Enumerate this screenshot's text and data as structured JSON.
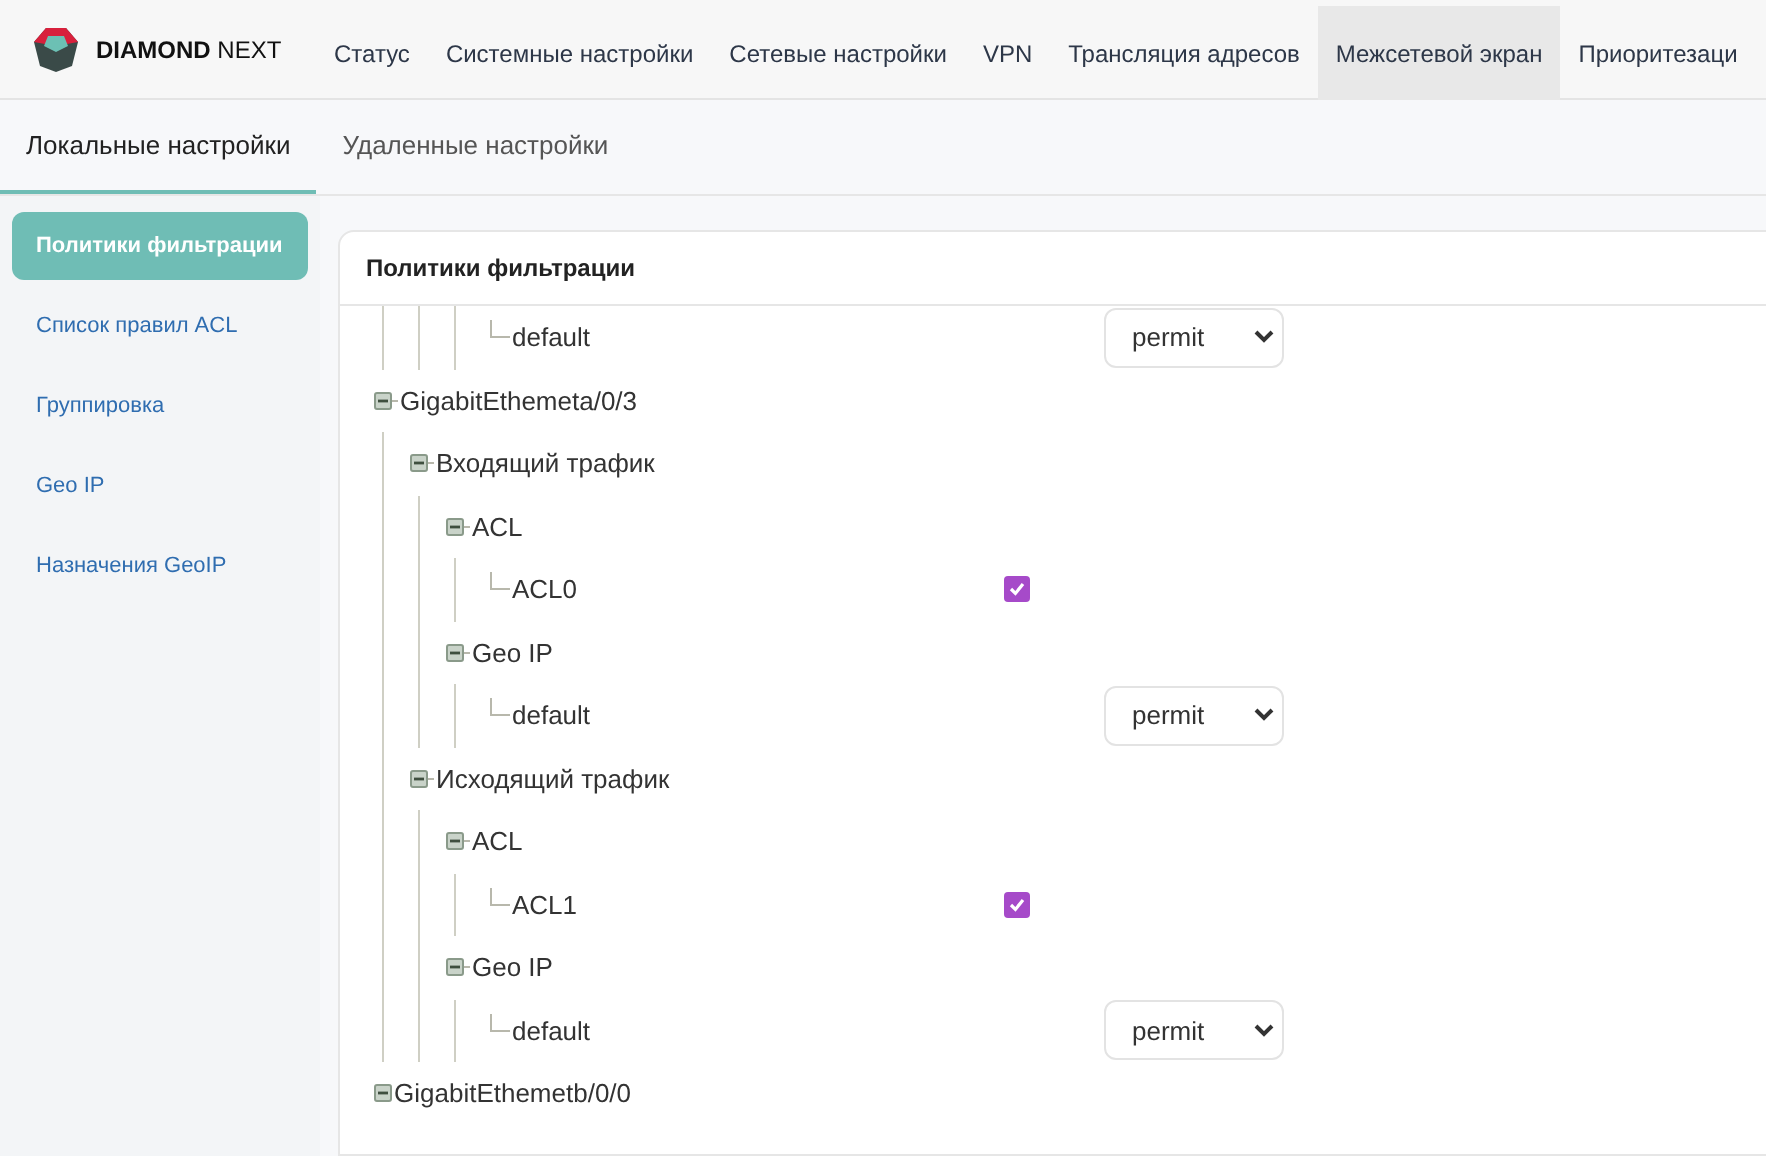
{
  "brand": {
    "name_bold": "DIAMOND",
    "name_light": "NEXT"
  },
  "nav": [
    {
      "label": "Статус",
      "selected": false
    },
    {
      "label": "Системные настройки",
      "selected": false
    },
    {
      "label": "Сетевые настройки",
      "selected": false
    },
    {
      "label": "VPN",
      "selected": false
    },
    {
      "label": "Трансляция адресов",
      "selected": false
    },
    {
      "label": "Межсетевой экран",
      "selected": true
    },
    {
      "label": "Приоритезаци",
      "selected": false
    }
  ],
  "subtabs": [
    {
      "label": "Локальные настройки",
      "selected": true
    },
    {
      "label": "Удаленные настройки",
      "selected": false
    }
  ],
  "sidebar": {
    "items": [
      {
        "label": "Политики фильтрации",
        "selected": true
      },
      {
        "label": "Список правил ACL",
        "selected": false
      },
      {
        "label": "Группировка",
        "selected": false
      },
      {
        "label": "Geo IP",
        "selected": false
      },
      {
        "label": "Назначения GeoIP",
        "selected": false
      }
    ]
  },
  "panel": {
    "title": "Политики фильтрации",
    "tree": [
      {
        "children": [
          {
            "children": [
              {
                "children": [
                  {
                    "label": "default",
                    "kind": "select",
                    "value": "permit"
                  }
                ]
              }
            ]
          }
        ]
      },
      {
        "label": "GigabitEthemeta/0/3",
        "expanded": true,
        "children": [
          {
            "label": "Входящий трафик",
            "expanded": true,
            "children": [
              {
                "label": "ACL",
                "expanded": true,
                "children": [
                  {
                    "label": "ACL0",
                    "kind": "checkbox",
                    "checked": true
                  }
                ]
              },
              {
                "label": "Geo IP",
                "expanded": true,
                "children": [
                  {
                    "label": "default",
                    "kind": "select",
                    "value": "permit"
                  }
                ]
              }
            ]
          },
          {
            "label": "Исходящий трафик",
            "expanded": true,
            "children": [
              {
                "label": "ACL",
                "expanded": true,
                "children": [
                  {
                    "label": "ACL1",
                    "kind": "checkbox",
                    "checked": true
                  }
                ]
              },
              {
                "label": "Geo IP",
                "expanded": true,
                "children": [
                  {
                    "label": "default",
                    "kind": "select",
                    "value": "permit"
                  }
                ]
              }
            ]
          }
        ]
      },
      {
        "label": "GigabitEthemetb/0/0",
        "expanded": true
      }
    ]
  }
}
